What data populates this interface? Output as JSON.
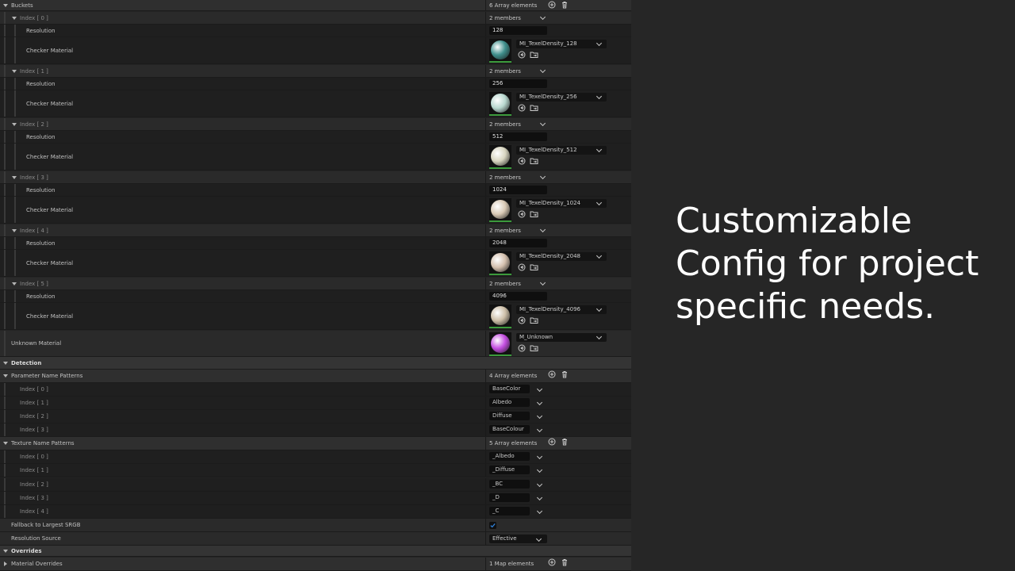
{
  "buckets": {
    "label": "Buckets",
    "count": "6 Array elements",
    "members": "2 members",
    "resolution_label": "Resolution",
    "checker_label": "Checker Material",
    "items": [
      {
        "index": "Index [ 0 ]",
        "resolution": "128",
        "material": "MI_TexelDensity_128",
        "ball_color": "#3f8f8c"
      },
      {
        "index": "Index [ 1 ]",
        "resolution": "256",
        "material": "MI_TexelDensity_256",
        "ball_color": "#b8d8cf"
      },
      {
        "index": "Index [ 2 ]",
        "resolution": "512",
        "material": "MI_TexelDensity_512",
        "ball_color": "#d8d5c0"
      },
      {
        "index": "Index [ 3 ]",
        "resolution": "1024",
        "material": "MI_TexelDensity_1024",
        "ball_color": "#d9c9b5"
      },
      {
        "index": "Index [ 4 ]",
        "resolution": "2048",
        "material": "MI_TexelDensity_2048",
        "ball_color": "#d4c0ae"
      },
      {
        "index": "Index [ 5 ]",
        "resolution": "4096",
        "material": "MI_TexelDensity_4096",
        "ball_color": "#cdbfa8"
      }
    ]
  },
  "unknown": {
    "label": "Unknown Material",
    "material": "M_Unknown",
    "ball_color": "#c44ee0"
  },
  "detection": {
    "label": "Detection",
    "param_patterns": {
      "label": "Parameter Name Patterns",
      "count": "4 Array elements",
      "items": [
        {
          "index": "Index [ 0 ]",
          "value": "BaseColor"
        },
        {
          "index": "Index [ 1 ]",
          "value": "Albedo"
        },
        {
          "index": "Index [ 2 ]",
          "value": "Diffuse"
        },
        {
          "index": "Index [ 3 ]",
          "value": "BaseColour"
        }
      ]
    },
    "texture_patterns": {
      "label": "Texture Name Patterns",
      "count": "5 Array elements",
      "items": [
        {
          "index": "Index [ 0 ]",
          "value": "_Albedo"
        },
        {
          "index": "Index [ 1 ]",
          "value": "_Diffuse"
        },
        {
          "index": "Index [ 2 ]",
          "value": "_BC"
        },
        {
          "index": "Index [ 3 ]",
          "value": "_D"
        },
        {
          "index": "Index [ 4 ]",
          "value": "_C"
        }
      ]
    },
    "fallback": {
      "label": "Fallback to Largest SRGB",
      "checked": true
    },
    "res_source": {
      "label": "Resolution Source",
      "value": "Effective"
    }
  },
  "overrides": {
    "label": "Overrides",
    "material_overrides": {
      "label": "Material Overrides",
      "count": "1 Map elements"
    }
  },
  "caption": "Customizable Config for project specific needs.",
  "colors": {
    "accent_green": "#3c9b3c",
    "checkbox_blue": "#2f7fd6",
    "caption": "#ffffff"
  },
  "icons": [
    "add-element-icon",
    "delete-icon",
    "browse-icon",
    "folder-icon",
    "chevron-down-icon",
    "checkmark-icon"
  ]
}
